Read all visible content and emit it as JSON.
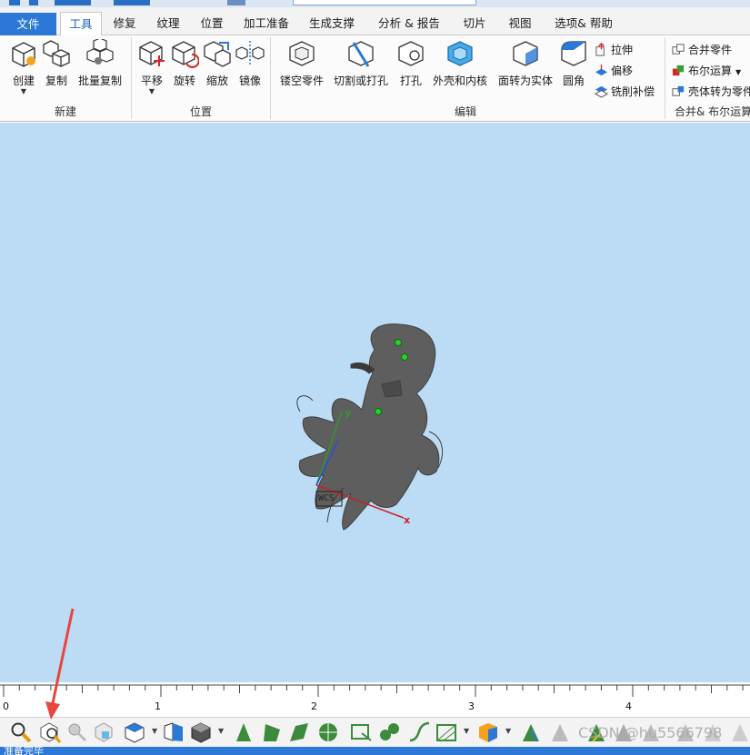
{
  "tabs": [
    {
      "label": "文件"
    },
    {
      "label": "工具"
    },
    {
      "label": "修复"
    },
    {
      "label": "纹理"
    },
    {
      "label": "位置"
    },
    {
      "label": "加工准备"
    },
    {
      "label": "生成支撑"
    },
    {
      "label": "分析 & 报告"
    },
    {
      "label": "切片"
    },
    {
      "label": "视图"
    },
    {
      "label": "选项& 帮助"
    }
  ],
  "ribbon": {
    "new_group": {
      "label": "新建",
      "create": "创建",
      "copy": "复制",
      "batch_copy": "批量复制"
    },
    "position_group": {
      "label": "位置",
      "translate": "平移",
      "rotate": "旋转",
      "scale": "缩放",
      "mirror": "镜像"
    },
    "edit_group": {
      "label": "编辑",
      "hollow": "镂空零件",
      "cut_punch": "切割或打孔",
      "punch": "打孔",
      "shell_core": "外壳和内核",
      "face_to_solid": "面转为实体",
      "fillet": "圆角",
      "extrude": "拉伸",
      "offset": "偏移",
      "mill_comp": "铣削补偿"
    },
    "merge_group": {
      "label": "合并& 布尔运算",
      "merge": "合并零件",
      "boolean": "布尔运算",
      "shell_to_part": "壳体转为零件"
    }
  },
  "viewport": {
    "axis_x": "x",
    "axis_y": "y",
    "wcs": "WCS",
    "background": "#bcdcf6"
  },
  "ruler": {
    "ticks": [
      "0",
      "1",
      "2",
      "3",
      "4"
    ]
  },
  "watermark": "CSDN @hu5566798",
  "status": "准备完毕",
  "colors": {
    "accent": "#2b78d6",
    "arrow": "#e8453c"
  }
}
